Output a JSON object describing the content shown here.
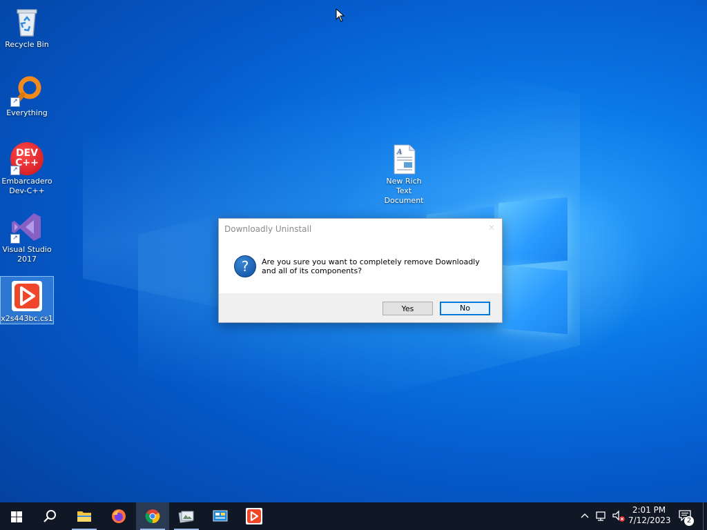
{
  "desktop": {
    "icons": [
      {
        "label": "Recycle Bin"
      },
      {
        "label": "Everything"
      },
      {
        "label_line1": "Embarcadero",
        "label_line2": "Dev-C++",
        "badge": "DEV C++"
      },
      {
        "label_line1": "Visual Studio",
        "label_line2": "2017"
      },
      {
        "label": "x2s443bc.cs1"
      },
      {
        "label_line1": "New Rich Text",
        "label_line2": "Document"
      }
    ]
  },
  "dialog": {
    "title": "Downloadly Uninstall",
    "close": "✕",
    "icon": "question-icon",
    "icon_glyph": "?",
    "message": "Are you sure you want to completely remove Downloadly and all of its components?",
    "yes_label": "Yes",
    "no_label": "No"
  },
  "taskbar": {
    "apps": [
      "start-icon",
      "search-icon",
      "file-explorer-icon",
      "firefox-icon",
      "chrome-icon",
      "image-viewer-icon",
      "control-panel-icon",
      "downloadly-icon"
    ],
    "active_app": "chrome-icon",
    "tray": {
      "time": "2:01 PM",
      "date": "7/12/2023",
      "notification_count": "2"
    }
  },
  "colors": {
    "accent": "#0078d7",
    "taskbar": "#101826",
    "desktop": "#0a6fdc"
  }
}
